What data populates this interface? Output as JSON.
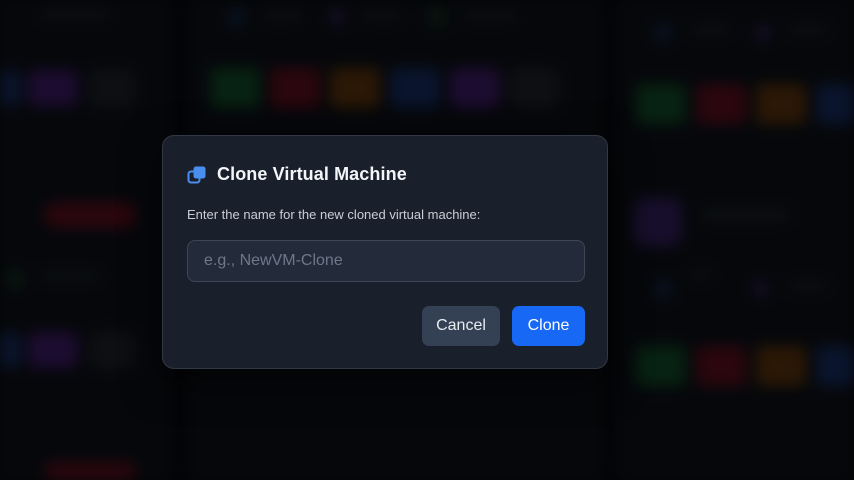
{
  "dialog": {
    "title": "Clone Virtual Machine",
    "icon": "clone-icon",
    "description": "Enter the name for the new cloned virtual machine:",
    "input": {
      "value": "",
      "placeholder": "e.g., NewVM-Clone"
    },
    "cancel_label": "Cancel",
    "confirm_label": "Clone"
  },
  "colors": {
    "accent": "#1668f5",
    "icon": "#4a8ef0",
    "dialog_bg": "#1a202b",
    "cancel_bg": "#344155"
  }
}
